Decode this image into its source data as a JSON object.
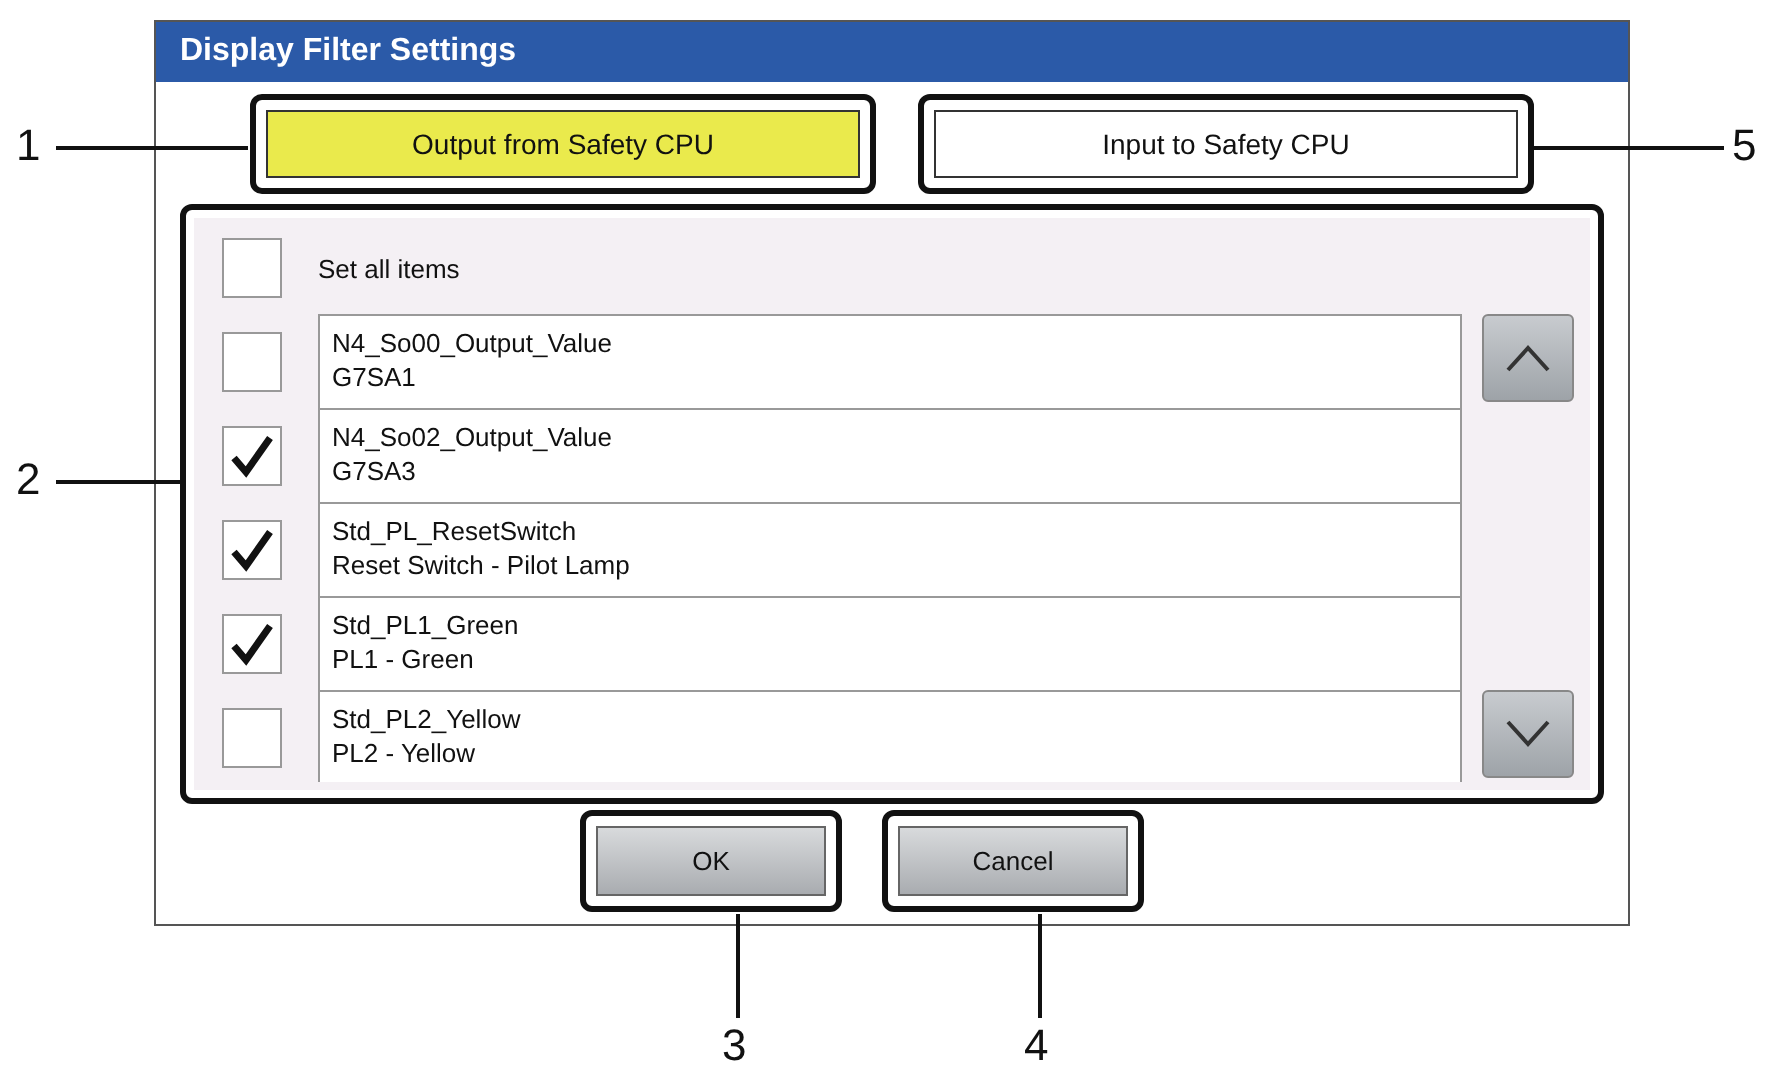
{
  "window": {
    "title": "Display Filter Settings"
  },
  "tabs": [
    {
      "label": "Output from Safety CPU",
      "selected": true
    },
    {
      "label": "Input to Safety CPU",
      "selected": false
    }
  ],
  "set_all": {
    "label": "Set all items",
    "checked": false
  },
  "items": [
    {
      "name": "N4_So00_Output_Value",
      "description": "G7SA1",
      "checked": false
    },
    {
      "name": "N4_So02_Output_Value",
      "description": "G7SA3",
      "checked": true
    },
    {
      "name": "Std_PL_ResetSwitch",
      "description": "Reset Switch - Pilot Lamp",
      "checked": true
    },
    {
      "name": "Std_PL1_Green",
      "description": "PL1 - Green",
      "checked": true
    },
    {
      "name": "Std_PL2_Yellow",
      "description": "PL2 - Yellow",
      "checked": false
    }
  ],
  "buttons": [
    {
      "label": "OK"
    },
    {
      "label": "Cancel"
    }
  ],
  "callouts": [
    {
      "label": "1"
    },
    {
      "label": "2"
    },
    {
      "label": "3"
    },
    {
      "label": "4"
    },
    {
      "label": "5"
    }
  ]
}
